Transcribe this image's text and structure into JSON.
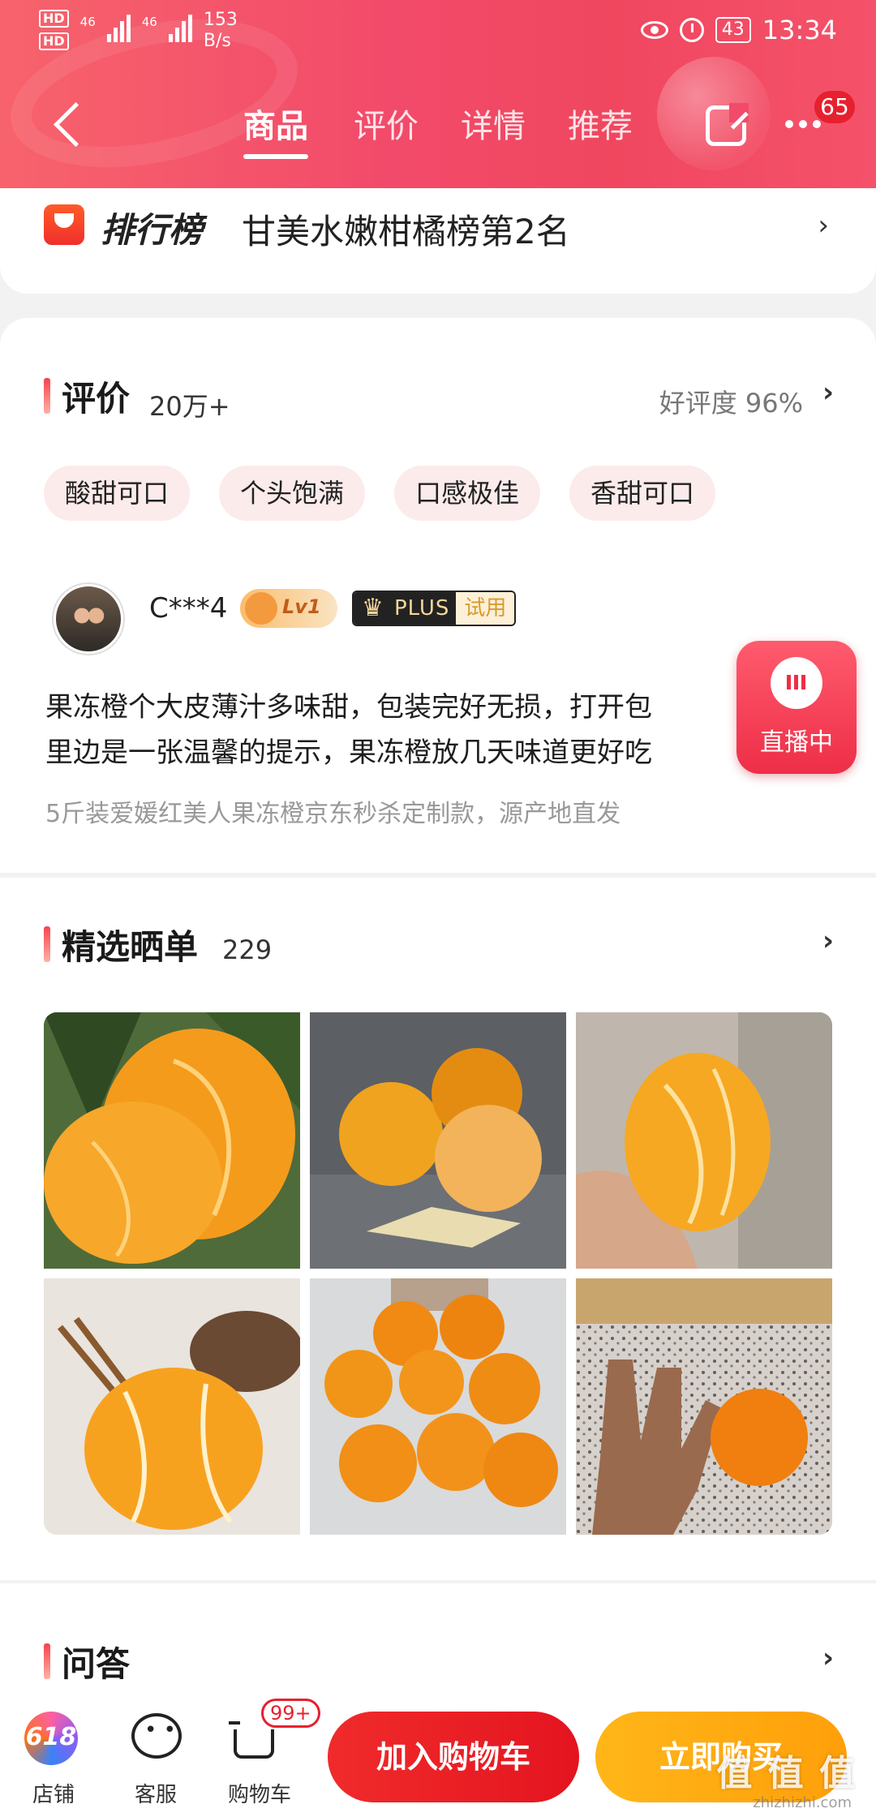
{
  "status_bar": {
    "hd1": "HD",
    "hd2": "HD",
    "signal1": "46",
    "signal2": "46",
    "net_speed": "153",
    "net_unit": "B/s",
    "battery": "43",
    "time": "13:34"
  },
  "nav": {
    "tabs": [
      "商品",
      "评价",
      "详情",
      "推荐"
    ],
    "active_tab": 0,
    "more_badge": "65"
  },
  "ranking": {
    "label": "排行榜",
    "text": "甘美水嫩柑橘榜第2名"
  },
  "reviews": {
    "title": "评价",
    "count": "20万+",
    "praise": "好评度 96%",
    "tags": [
      "酸甜可口",
      "个头饱满",
      "口感极佳",
      "香甜可口"
    ],
    "item": {
      "username": "C***4",
      "level_badge": "Lv1",
      "plus_label": "PLUS",
      "plus_trial": "试用",
      "text_line1": "果冻橙个大皮薄汁多味甜，包装完好无损，打开包",
      "text_line2": "里边是一张温馨的提示，果冻橙放几天味道更好吃",
      "sku": "5斤装爱媛红美人果冻橙京东秒杀定制款，源产地直发"
    }
  },
  "live": {
    "label": "直播中"
  },
  "photos": {
    "title": "精选晒单",
    "count": "229"
  },
  "qa": {
    "title": "问答"
  },
  "bottom_bar": {
    "shop_label": "店铺",
    "shop_icon_text": "618",
    "service_label": "客服",
    "cart_label": "购物车",
    "cart_badge": "99+",
    "add_cart": "加入购物车",
    "buy_now": "立即购买"
  },
  "watermark": {
    "text": "值 值 值",
    "sub": "zhizhizhi.com"
  },
  "colors": {
    "header": "#f24a6a",
    "add_cart": "#e4141f",
    "buy_now": "#ff9f0a",
    "accent": "#f6434d"
  }
}
